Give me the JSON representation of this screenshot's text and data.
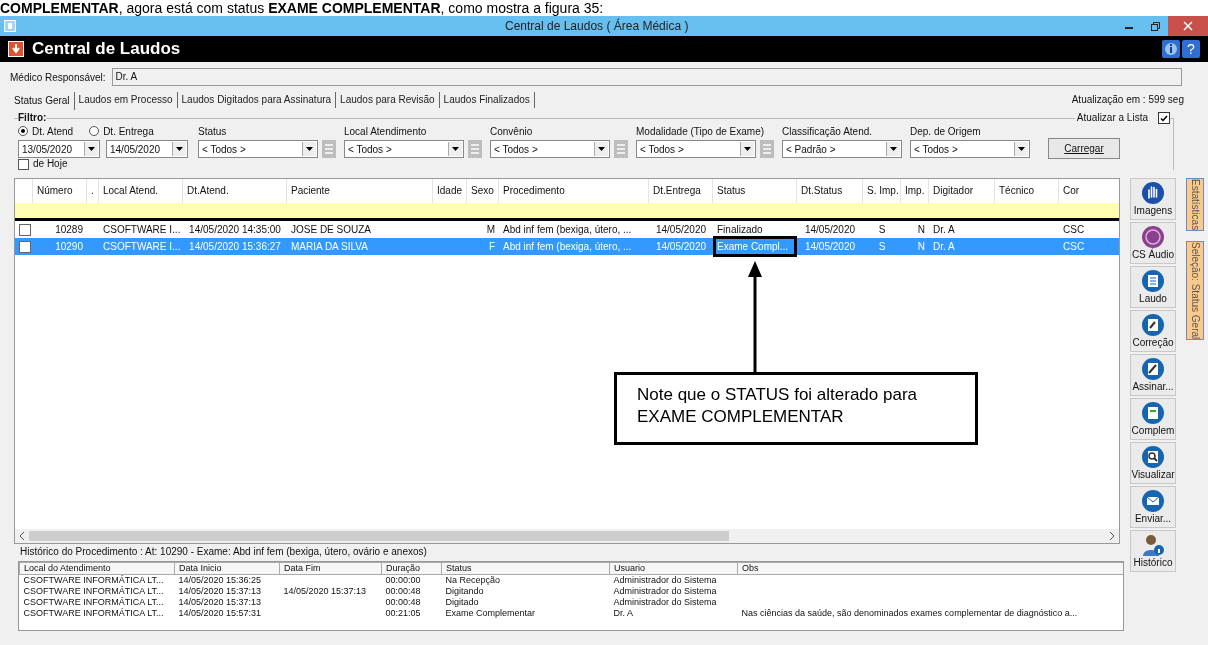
{
  "document_caption": "**COMPLEMENTAR**, agora está com status **EXAME COMPLEMENTAR**, como mostra a figura 35:",
  "window": {
    "title": "Central de Laudos ( Área Médica )"
  },
  "header": {
    "title": "Central de Laudos",
    "help_button": "?"
  },
  "medico": {
    "label": "Médico Responsável:",
    "value": "Dr. A"
  },
  "tabs": [
    {
      "label": "Status Geral",
      "selected": true
    },
    {
      "label": "Laudos em Processo",
      "selected": false
    },
    {
      "label": "Laudos Digitados para Assinatura",
      "selected": false
    },
    {
      "label": "Laudos para Revisão",
      "selected": false
    },
    {
      "label": "Laudos Finalizados",
      "selected": false
    }
  ],
  "refresh_info": "Atualização em : 599 seg",
  "filter": {
    "title": "Filtro:",
    "date_options": [
      {
        "label": "Dt. Atend",
        "selected": true
      },
      {
        "label": "Dt. Entrega",
        "selected": false
      }
    ],
    "date_from": "13/05/2020",
    "date_to": "14/05/2020",
    "today": {
      "label": "de Hoje",
      "checked": false
    },
    "dropdowns": [
      {
        "label": "Status",
        "value": "< Todos >",
        "picker": true
      },
      {
        "label": "Local Atendimento",
        "value": "< Todos >",
        "picker": true
      },
      {
        "label": "Convênio",
        "value": "< Todos >",
        "picker": true
      },
      {
        "label": "Modalidade (Tipo de Exame)",
        "value": "< Todos >",
        "picker": true
      },
      {
        "label": "Classificação Atend.",
        "value": "< Padrão >",
        "picker": false
      },
      {
        "label": "Dep. de Origem",
        "value": "< Todos >",
        "picker": false
      }
    ],
    "auto_refresh": {
      "label": "Atualizar a Lista",
      "checked": true
    },
    "load_button": "Carregar"
  },
  "table": {
    "columns": [
      "Número",
      ".",
      "Local Atend.",
      "Dt.Atend.",
      "Paciente",
      "Idade",
      "Sexo",
      "Procedimento",
      "Dt.Entrega",
      "Status",
      "Dt.Status",
      "S. Imp.",
      "Imp.",
      "Digitador",
      "Técnico",
      "Cor"
    ],
    "rows": [
      {
        "checked": false,
        "selected": false,
        "cells": [
          "10289",
          null,
          "CSOFTWARE I...",
          "14/05/2020 14:35:00",
          "JOSE DE SOUZA",
          null,
          "M",
          "Abd inf fem (bexiga, útero, ...",
          "14/05/2020",
          "Finalizado",
          "14/05/2020",
          "S",
          "N",
          "Dr. A",
          null,
          "CSC"
        ]
      },
      {
        "checked": false,
        "selected": true,
        "cells": [
          "10290",
          null,
          "CSOFTWARE I...",
          "14/05/2020 15:36:27",
          "MARIA DA SILVA",
          null,
          "F",
          "Abd inf fem (bexiga, útero, ...",
          "14/05/2020",
          "Exame Compl...",
          "14/05/2020",
          "S",
          "N",
          "Dr. A",
          null,
          "CSC"
        ]
      }
    ]
  },
  "side_buttons": [
    {
      "label": "Imagens",
      "kind": "hand"
    },
    {
      "label": "CS Áudio",
      "kind": "cs"
    },
    {
      "label": "Laudo",
      "kind": "doc"
    },
    {
      "label": "Correção",
      "kind": "correct"
    },
    {
      "label": "Assinar...",
      "kind": "sign"
    },
    {
      "label": "Complem",
      "kind": "complement"
    },
    {
      "label": "Visualizar",
      "kind": "view"
    },
    {
      "label": "Enviar...",
      "kind": "mail"
    },
    {
      "label": "Histórico",
      "kind": "user"
    }
  ],
  "side_tabs": [
    "Estatísticas",
    "Seleção: Status Geral"
  ],
  "callout": "Note que o STATUS foi alterado para EXAME COMPLEMENTAR",
  "history": {
    "title": "Histórico do Procedimento : At: 10290 - Exame: Abd inf fem (bexiga, útero, ovário e anexos)",
    "columns": [
      "Local do Atendimento",
      "Data Inicio",
      "Data Fim",
      "Duração",
      "Status",
      "Usuario",
      "Obs"
    ],
    "rows": [
      [
        "CSOFTWARE INFORMÁTICA LT...",
        "14/05/2020 15:36:25",
        null,
        "00:00:00",
        "Na Recepção",
        "Administrador do Sistema",
        null
      ],
      [
        "CSOFTWARE INFORMÁTICA LT...",
        "14/05/2020 15:37:13",
        "14/05/2020 15:37:13",
        "00:00:48",
        "Digitando",
        "Administrador do Sistema",
        null
      ],
      [
        "CSOFTWARE INFORMÁTICA LT...",
        "14/05/2020 15:37:13",
        null,
        "00:00:48",
        "Digitado",
        "Administrador do Sistema",
        null
      ],
      [
        "CSOFTWARE INFORMÁTICA LT...",
        "14/05/2020 15:57:31",
        null,
        "00:21:05",
        "Exame Complementar",
        "Dr. A",
        "Nas ciências da saúde, são denominados exames complementar de diagnóstico a..."
      ]
    ]
  }
}
